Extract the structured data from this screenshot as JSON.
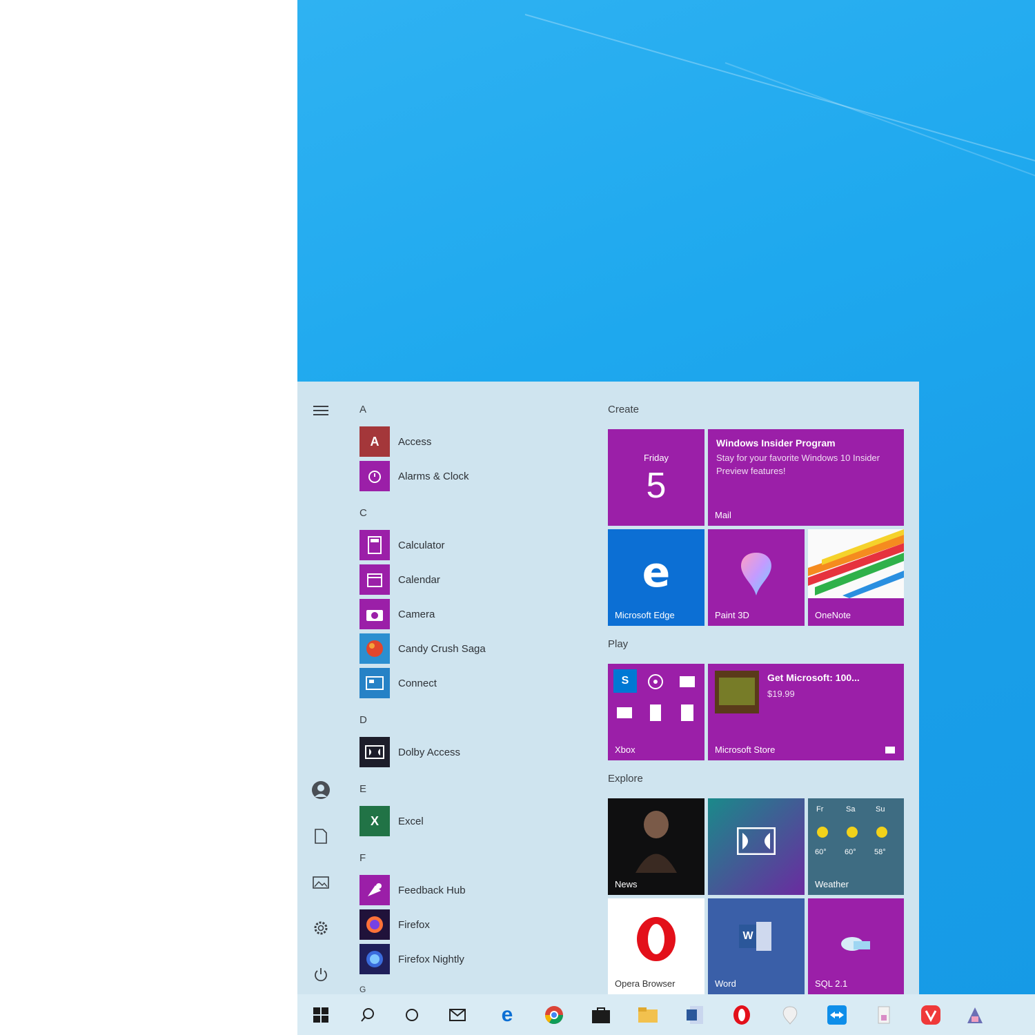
{
  "start_menu": {
    "rail": {
      "menu_icon": "hamburger-icon",
      "user_icon": "user-avatar-icon",
      "documents_icon": "document-icon",
      "pictures_icon": "pictures-icon",
      "settings_icon": "gear-icon",
      "power_icon": "power-icon"
    },
    "apps": {
      "letter_a": "A",
      "access": "Access",
      "alarms": "Alarms & Clock",
      "letter_c": "C",
      "calculator": "Calculator",
      "calendar": "Calendar",
      "camera": "Camera",
      "candy": "Candy Crush Saga",
      "connect": "Connect",
      "letter_d": "D",
      "dolby": "Dolby Access",
      "letter_e": "E",
      "excel": "Excel",
      "letter_f": "F",
      "feedback": "Feedback Hub",
      "firefox": "Firefox",
      "firefox_nightly": "Firefox Nightly",
      "letter_g": "G"
    },
    "tiles": {
      "create_header": "Create",
      "calendar_day": "Friday",
      "calendar_date": "5",
      "mail_title": "Windows Insider Program",
      "mail_body": "Stay for your favorite Windows 10 Insider Preview features!",
      "mail_label": "Mail",
      "edge_label": "Microsoft Edge",
      "paint3d_label": "Paint 3D",
      "onenote_label": "OneNote",
      "play_header": "Play",
      "play_label": "Xbox",
      "store_title": "Get Microsoft: 100...",
      "store_price": "$19.99",
      "store_label": "Microsoft Store",
      "explore_header": "Explore",
      "news_label": "News",
      "weather_label": "Weather",
      "weather_day1": "Fr",
      "weather_day2": "Sa",
      "weather_day3": "Su",
      "weather_temp1": "60°",
      "weather_temp2": "60°",
      "weather_temp3": "58°",
      "opera_label": "Opera Browser",
      "word_label": "Word",
      "sql_label": "SQL 2.1"
    }
  },
  "taskbar": {
    "items": [
      "windows-start-icon",
      "search-icon",
      "task-view-icon",
      "mail-icon",
      "edge-icon",
      "chrome-icon",
      "store-icon",
      "file-explorer-icon",
      "word-icon",
      "opera-icon",
      "paint-icon",
      "teamviewer-icon",
      "app-icon",
      "vivaldi-icon",
      "app2-icon"
    ]
  }
}
